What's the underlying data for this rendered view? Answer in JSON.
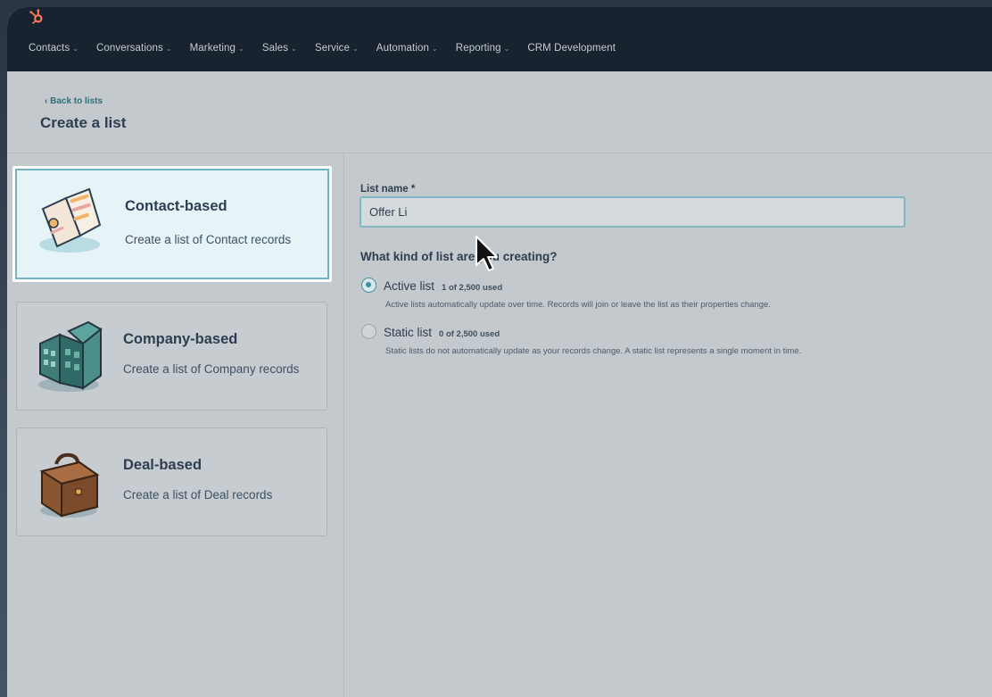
{
  "nav": {
    "items": [
      {
        "label": "Contacts",
        "has_dropdown": true
      },
      {
        "label": "Conversations",
        "has_dropdown": true
      },
      {
        "label": "Marketing",
        "has_dropdown": true
      },
      {
        "label": "Sales",
        "has_dropdown": true
      },
      {
        "label": "Service",
        "has_dropdown": true
      },
      {
        "label": "Automation",
        "has_dropdown": true
      },
      {
        "label": "Reporting",
        "has_dropdown": true
      },
      {
        "label": "CRM Development",
        "has_dropdown": false
      }
    ],
    "chevron": "⌄",
    "logo_icon": "hubspot-sprocket-icon",
    "logo_color": "#ff7a59"
  },
  "header": {
    "back_link": "‹  Back to lists",
    "title": "Create a list"
  },
  "list_types": [
    {
      "title": "Contact-based",
      "description": "Create a list of Contact records",
      "selected": true,
      "icon": "contact-card-icon"
    },
    {
      "title": "Company-based",
      "description": "Create a list of Company records",
      "selected": false,
      "icon": "building-icon"
    },
    {
      "title": "Deal-based",
      "description": "Create a list of Deal records",
      "selected": false,
      "icon": "briefcase-icon"
    }
  ],
  "form": {
    "list_name_label": "List name *",
    "list_name_value": "Offer Li",
    "question": "What kind of list are you creating?",
    "options": [
      {
        "label": "Active list",
        "usage": "1 of 2,500 used",
        "description": "Active lists automatically update over time. Records will join or leave the list as their properties change.",
        "checked": true
      },
      {
        "label": "Static list",
        "usage": "0 of 2,500 used",
        "description": "Static lists do not automatically update as your records change. A static list represents a single moment in time.",
        "checked": false
      }
    ]
  },
  "colors": {
    "accent": "#73b4c4",
    "nav_bg": "#18232f",
    "title_text": "#2d3e50"
  }
}
